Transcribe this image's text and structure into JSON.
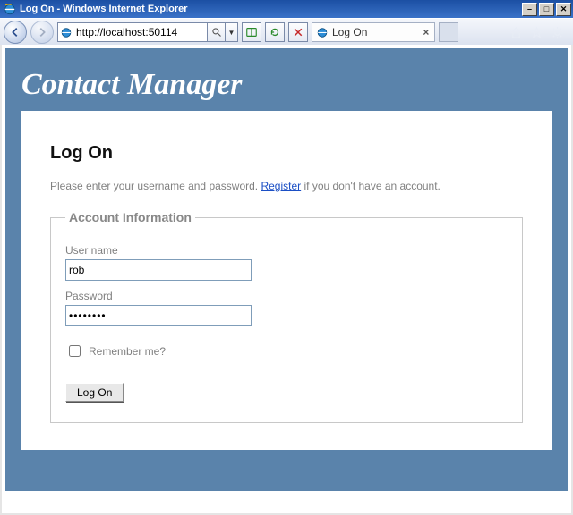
{
  "window": {
    "title": "Log On - Windows Internet Explorer"
  },
  "toolbar": {
    "url": "http://localhost:50114",
    "tab_title": "Log On"
  },
  "page": {
    "brand": "Contact Manager",
    "heading": "Log On",
    "instruction_pre": "Please enter your username and password. ",
    "register_link": "Register",
    "instruction_post": " if you don't have an account.",
    "fieldset_legend": "Account Information",
    "username_label": "User name",
    "username_value": "rob",
    "password_label": "Password",
    "password_value": "••••••••",
    "remember_label": "Remember me?",
    "submit_label": "Log On"
  }
}
